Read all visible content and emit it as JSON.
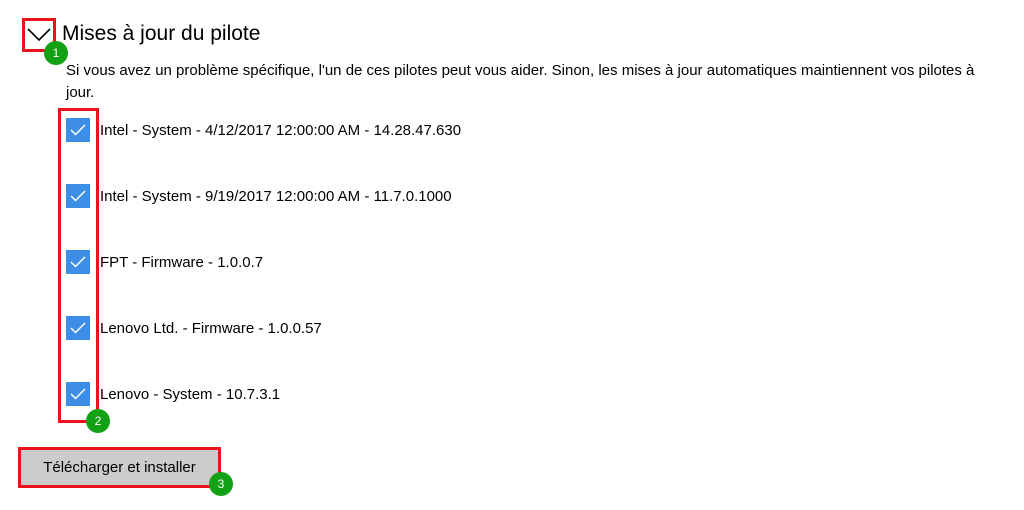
{
  "section": {
    "title": "Mises à jour du pilote",
    "description": "Si vous avez un problème spécifique, l'un de ces pilotes peut vous aider. Sinon, les mises à jour automatiques maintiennent vos pilotes à jour.",
    "toggle_icon": "chevron-down-icon"
  },
  "drivers": [
    {
      "label": "Intel - System - 4/12/2017 12:00:00 AM - 14.28.47.630",
      "checked": true
    },
    {
      "label": "Intel - System - 9/19/2017 12:00:00 AM - 11.7.0.1000",
      "checked": true
    },
    {
      "label": "FPT - Firmware - 1.0.0.7",
      "checked": true
    },
    {
      "label": "Lenovo Ltd. - Firmware - 1.0.0.57",
      "checked": true
    },
    {
      "label": "Lenovo - System - 10.7.3.1",
      "checked": true
    }
  ],
  "install_button": {
    "label": "Télécharger et installer"
  },
  "annotations": {
    "badge_1": "1",
    "badge_2": "2",
    "badge_3": "3"
  },
  "colors": {
    "checkbox_fill": "#3d8ee6",
    "highlight_border": "#e8131b",
    "badge_fill": "#12a015",
    "button_fill": "#cccccc"
  }
}
